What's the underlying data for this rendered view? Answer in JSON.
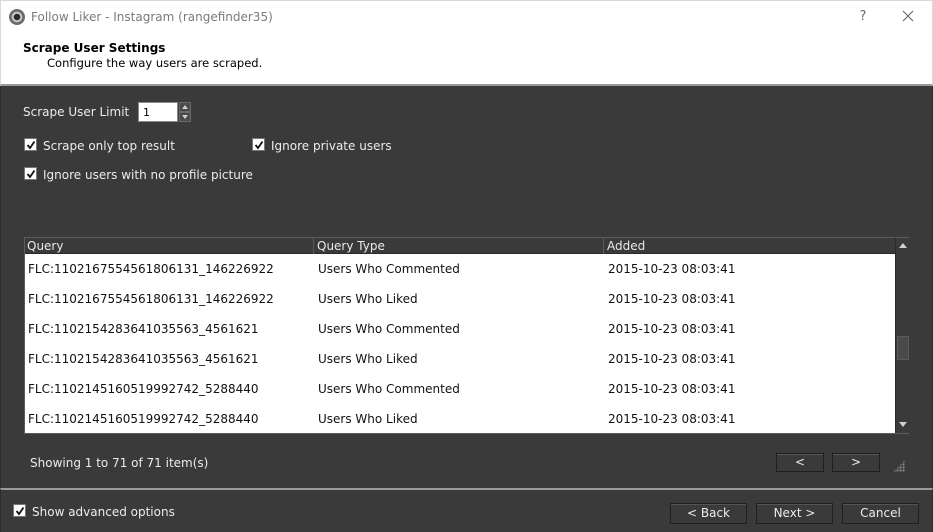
{
  "window": {
    "title": "Follow Liker - Instagram (rangefinder35)",
    "help_label": "?"
  },
  "header": {
    "title": "Scrape User Settings",
    "subtitle": "Configure the way users are scraped."
  },
  "settings": {
    "limit_label": "Scrape User Limit",
    "limit_value": "1",
    "checkboxes": [
      {
        "label": "Scrape only top result",
        "checked": true
      },
      {
        "label": "Ignore private users",
        "checked": true
      },
      {
        "label": "Ignore users with no profile picture",
        "checked": true
      }
    ]
  },
  "table": {
    "columns": [
      "Query",
      "Query Type",
      "Added"
    ],
    "rows": [
      [
        "FLC:1102167554561806131_146226922",
        "Users Who Commented",
        "2015-10-23 08:03:41"
      ],
      [
        "FLC:1102167554561806131_146226922",
        "Users Who Liked",
        "2015-10-23 08:03:41"
      ],
      [
        "FLC:1102154283641035563_4561621",
        "Users Who Commented",
        "2015-10-23 08:03:41"
      ],
      [
        "FLC:1102154283641035563_4561621",
        "Users Who Liked",
        "2015-10-23 08:03:41"
      ],
      [
        "FLC:1102145160519992742_5288440",
        "Users Who Commented",
        "2015-10-23 08:03:41"
      ],
      [
        "FLC:1102145160519992742_5288440",
        "Users Who Liked",
        "2015-10-23 08:03:41"
      ]
    ]
  },
  "pager": {
    "status": "Showing 1 to 71 of 71 item(s)",
    "prev_label": "<",
    "next_label": ">"
  },
  "footer": {
    "advanced_label": "Show advanced options",
    "advanced_checked": true,
    "back_label": "< Back",
    "next_label": "Next >",
    "cancel_label": "Cancel"
  },
  "icons": {
    "app": "camera-lens-icon",
    "close": "close-icon",
    "check": "checkmark-icon"
  }
}
